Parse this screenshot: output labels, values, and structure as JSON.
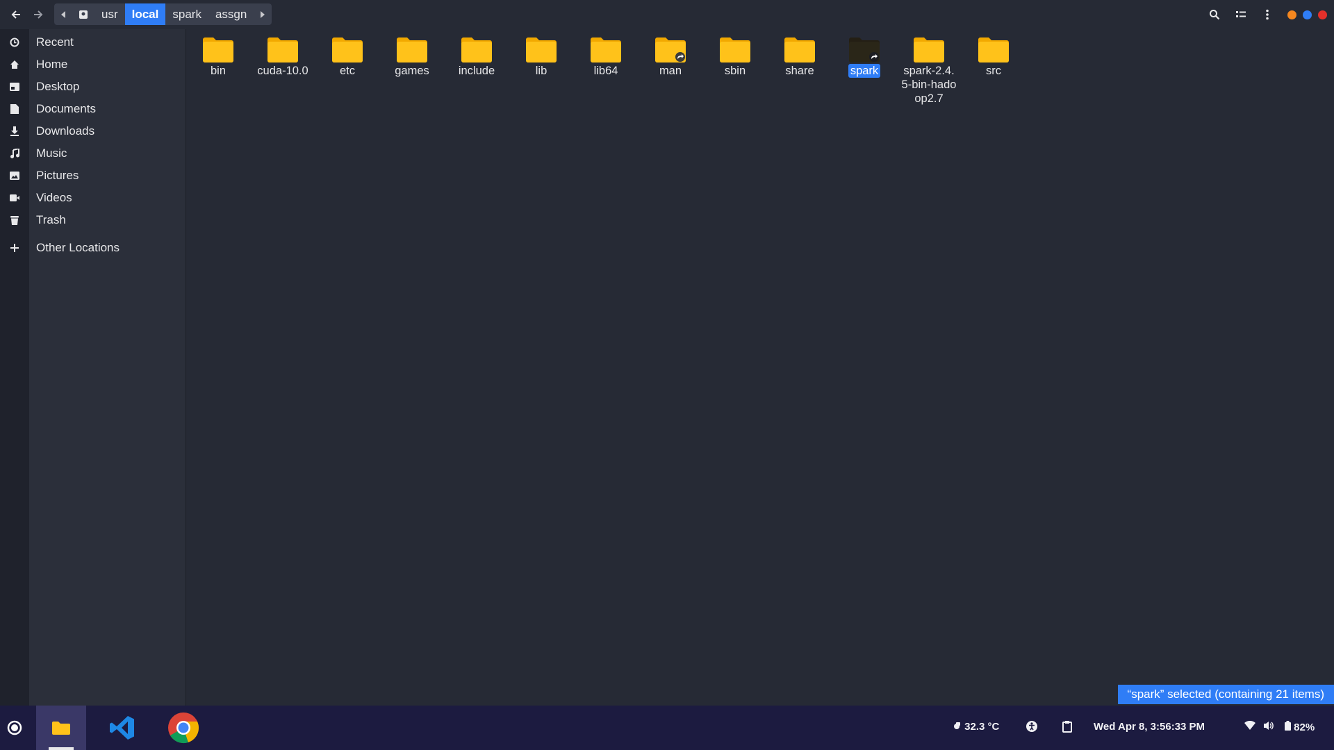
{
  "breadcrumbs": [
    {
      "label": "usr",
      "active": false
    },
    {
      "label": "local",
      "active": true
    },
    {
      "label": "spark",
      "active": false
    },
    {
      "label": "assgn",
      "active": false
    }
  ],
  "sidebar": {
    "items": [
      {
        "label": "Recent",
        "icon": "clock-icon"
      },
      {
        "label": "Home",
        "icon": "home-icon"
      },
      {
        "label": "Desktop",
        "icon": "desktop-icon"
      },
      {
        "label": "Documents",
        "icon": "document-icon"
      },
      {
        "label": "Downloads",
        "icon": "download-icon"
      },
      {
        "label": "Music",
        "icon": "music-icon"
      },
      {
        "label": "Pictures",
        "icon": "picture-icon"
      },
      {
        "label": "Videos",
        "icon": "video-icon"
      },
      {
        "label": "Trash",
        "icon": "trash-icon"
      }
    ],
    "other_locations": "Other Locations"
  },
  "files": [
    {
      "name": "bin"
    },
    {
      "name": "cuda-10.0"
    },
    {
      "name": "etc"
    },
    {
      "name": "games"
    },
    {
      "name": "include"
    },
    {
      "name": "lib"
    },
    {
      "name": "lib64"
    },
    {
      "name": "man",
      "link": true
    },
    {
      "name": "sbin"
    },
    {
      "name": "share"
    },
    {
      "name": "spark",
      "link": true,
      "selected": true
    },
    {
      "name": "spark-2.4.5-bin-hadoop2.7"
    },
    {
      "name": "src"
    }
  ],
  "status_text": "“spark” selected  (containing 21 items)",
  "taskbar": {
    "temperature": "32.3 °C",
    "datetime": "Wed Apr  8,  3:56:33 PM",
    "battery": "82%"
  },
  "colors": {
    "accent": "#2f7df6",
    "folder": "#ffc21a",
    "background": "#262a35",
    "taskbar": "#1c1b40"
  }
}
